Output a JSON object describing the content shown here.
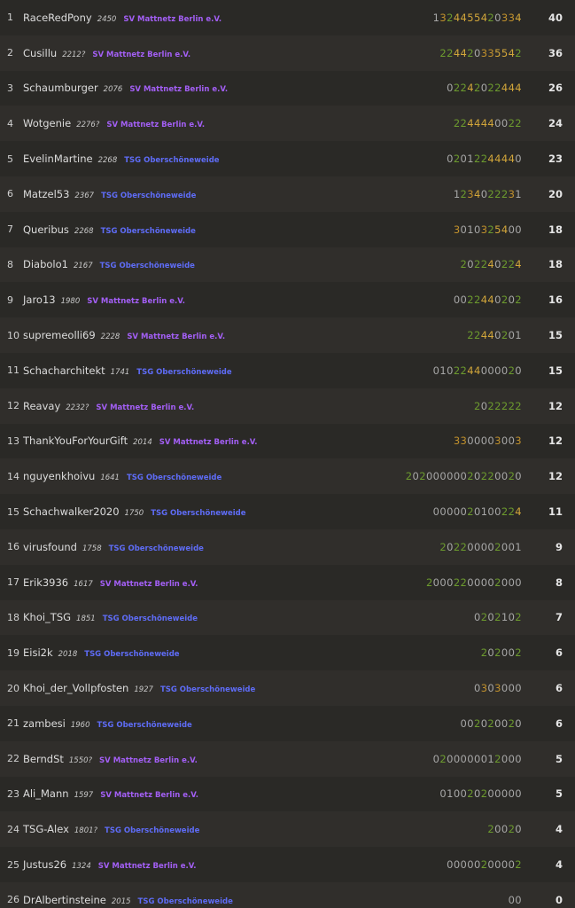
{
  "standings": [
    {
      "rank": "1",
      "name": "RaceRedPony",
      "rating": "2450",
      "team": "SV Mattnetz Berlin e.V.",
      "team_key": "mattnetz",
      "sheet": "1324455420334",
      "score": "40"
    },
    {
      "rank": "2",
      "name": "Cusillu",
      "rating": "2212?",
      "team": "SV Mattnetz Berlin e.V.",
      "team_key": "mattnetz",
      "sheet": "224420335542",
      "score": "36"
    },
    {
      "rank": "3",
      "name": "Schaumburger",
      "rating": "2076",
      "team": "SV Mattnetz Berlin e.V.",
      "team_key": "mattnetz",
      "sheet": "02242022444",
      "score": "26"
    },
    {
      "rank": "4",
      "name": "Wotgenie",
      "rating": "2276?",
      "team": "SV Mattnetz Berlin e.V.",
      "team_key": "mattnetz",
      "sheet": "2244440022",
      "score": "24"
    },
    {
      "rank": "5",
      "name": "EvelinMartine",
      "rating": "2268",
      "team": "TSG Oberschöneweide",
      "team_key": "tsg",
      "sheet": "02012244440",
      "score": "23"
    },
    {
      "rank": "6",
      "name": "Matzel53",
      "rating": "2367",
      "team": "TSG Oberschöneweide",
      "team_key": "tsg",
      "sheet": "1234022231",
      "score": "20"
    },
    {
      "rank": "7",
      "name": "Queribus",
      "rating": "2268",
      "team": "TSG Oberschöneweide",
      "team_key": "tsg",
      "sheet": "3010325400",
      "score": "18"
    },
    {
      "rank": "8",
      "name": "Diabolo1",
      "rating": "2167",
      "team": "TSG Oberschöneweide",
      "team_key": "tsg",
      "sheet": "202240224",
      "score": "18"
    },
    {
      "rank": "9",
      "name": "Jaro13",
      "rating": "1980",
      "team": "SV Mattnetz Berlin e.V.",
      "team_key": "mattnetz",
      "sheet": "002244020 2",
      "score": "16"
    },
    {
      "rank": "10",
      "name": "supremeolli69",
      "rating": "2228",
      "team": "SV Mattnetz Berlin e.V.",
      "team_key": "mattnetz",
      "sheet": "22440201",
      "score": "15"
    },
    {
      "rank": "11",
      "name": "Schacharchitekt",
      "rating": "1741",
      "team": "TSG Oberschöneweide",
      "team_key": "tsg",
      "sheet": "0102244000020",
      "score": "15"
    },
    {
      "rank": "12",
      "name": "Reavay",
      "rating": "2232?",
      "team": "SV Mattnetz Berlin e.V.",
      "team_key": "mattnetz",
      "sheet": "2022222",
      "score": "12"
    },
    {
      "rank": "13",
      "name": "ThankYouForYourGift",
      "rating": "2014",
      "team": "SV Mattnetz Berlin e.V.",
      "team_key": "mattnetz",
      "sheet": "3300003003",
      "score": "12"
    },
    {
      "rank": "14",
      "name": "nguyenkhoivu",
      "rating": "1641",
      "team": "TSG Oberschöneweide",
      "team_key": "tsg",
      "sheet": "20200000020220020",
      "score": "12"
    },
    {
      "rank": "15",
      "name": "Schachwalker2020",
      "rating": "1750",
      "team": "TSG Oberschöneweide",
      "team_key": "tsg",
      "sheet": "000002010022 4",
      "score": "11"
    },
    {
      "rank": "16",
      "name": "virusfound",
      "rating": "1758",
      "team": "TSG Oberschöneweide",
      "team_key": "tsg",
      "sheet": "202200002001",
      "score": "9"
    },
    {
      "rank": "17",
      "name": "Erik3936",
      "rating": "1617",
      "team": "SV Mattnetz Berlin e.V.",
      "team_key": "mattnetz",
      "sheet": "20002200002000",
      "score": "8"
    },
    {
      "rank": "18",
      "name": "Khoi_TSG",
      "rating": "1851",
      "team": "TSG Oberschöneweide",
      "team_key": "tsg",
      "sheet": "0202102",
      "score": "7"
    },
    {
      "rank": "19",
      "name": "Eisi2k",
      "rating": "2018",
      "team": "TSG Oberschöneweide",
      "team_key": "tsg",
      "sheet": "202002",
      "score": "6"
    },
    {
      "rank": "20",
      "name": "Khoi_der_Vollpfosten",
      "rating": "1927",
      "team": "TSG Oberschöneweide",
      "team_key": "tsg",
      "sheet": "0303000",
      "score": "6"
    },
    {
      "rank": "21",
      "name": "zambesi",
      "rating": "1960",
      "team": "TSG Oberschöneweide",
      "team_key": "tsg",
      "sheet": "002020020",
      "score": "6"
    },
    {
      "rank": "22",
      "name": "BerndSt",
      "rating": "1550?",
      "team": "SV Mattnetz Berlin e.V.",
      "team_key": "mattnetz",
      "sheet": "0200000012000",
      "score": "5"
    },
    {
      "rank": "23",
      "name": "Ali_Mann",
      "rating": "1597",
      "team": "SV Mattnetz Berlin e.V.",
      "team_key": "mattnetz",
      "sheet": "010020200000",
      "score": "5"
    },
    {
      "rank": "24",
      "name": "TSG-Alex",
      "rating": "1801?",
      "team": "TSG Oberschöneweide",
      "team_key": "tsg",
      "sheet": "20020",
      "score": "4"
    },
    {
      "rank": "25",
      "name": "Justus26",
      "rating": "1324",
      "team": "SV Mattnetz Berlin e.V.",
      "team_key": "mattnetz",
      "sheet": "00000200002",
      "score": "4"
    },
    {
      "rank": "26",
      "name": "DrAlbertinsteine",
      "rating": "2015",
      "team": "TSG Oberschöneweide",
      "team_key": "tsg",
      "sheet": "00",
      "score": "0"
    }
  ],
  "colors": {
    "row_odd": "#2a2926",
    "row_even": "#302e2b",
    "team_mattnetz": "#a35ff5",
    "team_tsg": "#5e6cf6",
    "streak_green": "#6c9a2e",
    "streak_orange": "#d2a63a",
    "score_text": "#e6e6e6"
  }
}
